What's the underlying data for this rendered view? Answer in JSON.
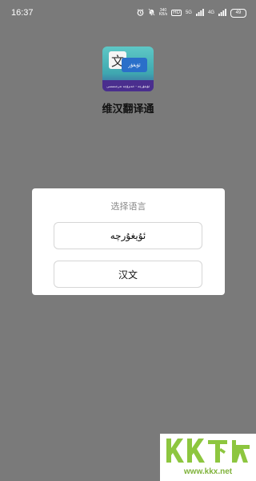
{
  "status_bar": {
    "time": "16:37",
    "speed_value": "340",
    "speed_unit": "KB/s",
    "hd_badge": "HD",
    "net_5g": "5G",
    "net_4g": "4G",
    "battery": "49"
  },
  "app": {
    "name": "维汉翻译通",
    "logo_glyph": "文",
    "logo_card_text": "ئۇيغۇر",
    "logo_band_text": "ئۇيغۇرچە - خەنزۇچە تەرجىمىسى"
  },
  "dialog": {
    "title": "选择语言",
    "options": [
      {
        "label": "ئۇيغۇرچە"
      },
      {
        "label": "汉文"
      }
    ]
  },
  "watermark": {
    "logo_text": "KK下载",
    "url": "www.kkx.net"
  }
}
